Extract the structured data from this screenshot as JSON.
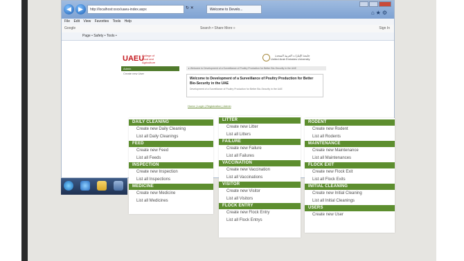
{
  "browser": {
    "address": "http://localhost:xxxx/uaeu-index.aspx",
    "tab_title": "Welcome to Develo...",
    "menu": [
      "File",
      "Edit",
      "View",
      "Favorites",
      "Tools",
      "Help"
    ],
    "google_label": "Google",
    "google_tools": "Search •  Share  More »",
    "signin": "Sign In",
    "cmd_left": "Page •  Safety •  Tools •"
  },
  "site": {
    "logo": "UAEU",
    "logo_sub": "College of Food and Agriculture",
    "university_ar": "جامعة الإمارات العربية المتحدة",
    "university_en": "United Arab Emirates University",
    "leftnav": {
      "header": "Admin",
      "item": "Create new User"
    },
    "breadcrumb": "▸ Welcome to Development of a Surveillance of Poultry Production for Better Bio-Security in the UAE",
    "welcome_title": "Welcome to Development of a Surveillance of Poultry Production for Better Bio-Security in the UAE",
    "welcome_body": "Development of a Surveillance of Poultry Production for Better Bio-Security in the UAE",
    "footer_link": "Home | Login | Registration | Admin"
  },
  "menus": {
    "col1": [
      {
        "header": "Daily Cleaning",
        "items": [
          "Create new Daily Cleaning",
          "List all Daily Cleanings"
        ]
      },
      {
        "header": "Feed",
        "items": [
          "Create new Feed",
          "List all Feeds"
        ]
      },
      {
        "header": "Inspection",
        "items": [
          "Create new Inspection",
          "List all Inspections"
        ]
      },
      {
        "header": "Medicine",
        "items": [
          "Create new Medicine",
          "List all Medicines"
        ]
      }
    ],
    "col2": [
      {
        "header": "Litter",
        "items": [
          "Create new Litter",
          "List all Litters"
        ]
      },
      {
        "header": "Failure",
        "items": [
          "Create new Failure",
          "List all Failures"
        ]
      },
      {
        "header": "Vaccination",
        "items": [
          "Create new Vaccination",
          "List all Vaccinations"
        ]
      },
      {
        "header": "Visitor",
        "items": [
          "Create new Visitor",
          "List all Visitors"
        ]
      },
      {
        "header": "Flock Entry",
        "items": [
          "Create new Flock Entry",
          "List all Flock Entrys"
        ]
      }
    ],
    "col3": [
      {
        "header": "Rodent",
        "items": [
          "Create new Rodent",
          "List all Rodents"
        ]
      },
      {
        "header": "Maintenance",
        "items": [
          "Create new Maintenance",
          "List all Maintenances"
        ]
      },
      {
        "header": "Flock Exit",
        "items": [
          "Create new Flock Exit",
          "List all Flock Exits"
        ]
      },
      {
        "header": "Initial Cleaning",
        "items": [
          "Create new Initial Cleaning",
          "List all Initial Cleanings"
        ]
      },
      {
        "header": "Users",
        "items": [
          "Create new User"
        ]
      }
    ]
  },
  "colors": {
    "accent_green": "#5d8e2f",
    "brand_red": "#c4161c",
    "slide_bg": "#e6e5e1"
  }
}
